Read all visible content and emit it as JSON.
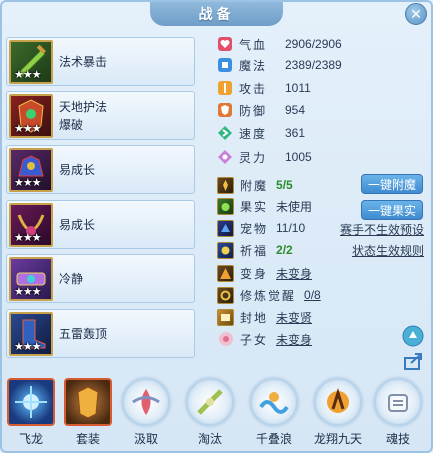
{
  "title": "战备",
  "equipment": [
    {
      "lines": [
        "法术暴击"
      ],
      "stars": "★★★"
    },
    {
      "lines": [
        "天地护法",
        "爆破"
      ],
      "stars": "★★★"
    },
    {
      "lines": [
        "易成长"
      ],
      "stars": "★★★"
    },
    {
      "lines": [
        "易成长"
      ],
      "stars": "★★★"
    },
    {
      "lines": [
        "冷静"
      ],
      "stars": "★★★"
    },
    {
      "lines": [
        "五雷轰顶"
      ],
      "stars": "★★★"
    }
  ],
  "stats": [
    {
      "icon": "heart-icon",
      "label": "气血",
      "value": "2906/2906",
      "color": "#e0506a"
    },
    {
      "icon": "mana-icon",
      "label": "魔法",
      "value": "2389/2389",
      "color": "#3a8fe0"
    },
    {
      "icon": "attack-icon",
      "label": "攻击",
      "value": "1011",
      "color": "#f0a030"
    },
    {
      "icon": "defense-icon",
      "label": "防御",
      "value": "954",
      "color": "#e07838"
    },
    {
      "icon": "speed-icon",
      "label": "速度",
      "value": "361",
      "color": "#30b880"
    },
    {
      "icon": "spirit-icon",
      "label": "灵力",
      "value": "1005",
      "color": "#c880d8"
    }
  ],
  "attrs": [
    {
      "label": "附魔",
      "value": "5/5",
      "style": "green"
    },
    {
      "label": "果实",
      "value": "未使用",
      "style": "plain"
    },
    {
      "label": "宠物",
      "value": "11/10",
      "style": "plain"
    },
    {
      "label": "祈福",
      "value": "2/2",
      "style": "green"
    },
    {
      "label": "变身",
      "value": "未变身",
      "style": "underline"
    },
    {
      "label": "修炼觉醒",
      "value": "0/8",
      "style": "underline"
    },
    {
      "label": "封地",
      "value": "未变贤",
      "style": "underline"
    },
    {
      "label": "子女",
      "value": "未变身",
      "style": "underline"
    }
  ],
  "buttons": {
    "one_click_enchant": "一键附魔",
    "one_click_fruit": "一键果实",
    "preset_link": "赛手不生效预设",
    "status_rule_link": "状态生效规则"
  },
  "skills": [
    {
      "label": "飞龙",
      "kind": "square"
    },
    {
      "label": "套装",
      "kind": "square"
    },
    {
      "label": "汲取",
      "kind": "ring"
    },
    {
      "label": "淘汰",
      "kind": "ring"
    },
    {
      "label": "千叠浪",
      "kind": "ring"
    },
    {
      "label": "龙翔九天",
      "kind": "ring"
    },
    {
      "label": "魂技",
      "kind": "ring"
    }
  ],
  "colors": {
    "accent_blue": "#3e8ad0",
    "green_value": "#2c8d2c",
    "frame_border": "#9cc3e3"
  }
}
